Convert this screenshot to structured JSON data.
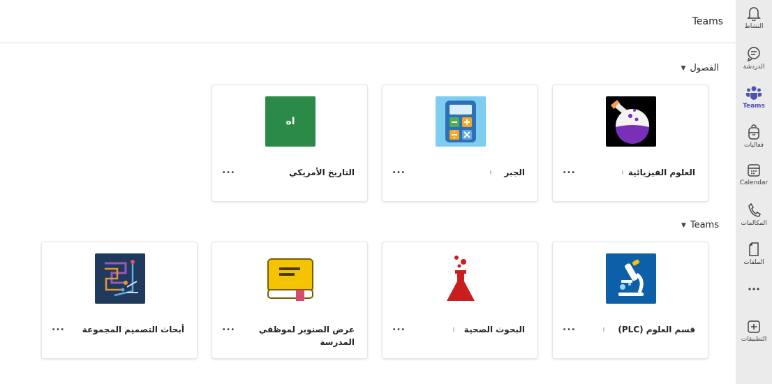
{
  "header": {
    "title": "Teams"
  },
  "rail": {
    "items": [
      {
        "label": "النشاط",
        "icon": "bell-icon"
      },
      {
        "label": "الدردشة",
        "icon": "chat-icon"
      },
      {
        "label": "Teams",
        "icon": "teams-icon",
        "active": true
      },
      {
        "label": "فعاليات",
        "icon": "backpack-icon"
      },
      {
        "label": "Calendar",
        "icon": "calendar-icon"
      },
      {
        "label": "المكالمات",
        "icon": "phone-icon"
      },
      {
        "label": "الملفات",
        "icon": "file-icon"
      },
      {
        "label": "",
        "icon": "more-icon"
      },
      {
        "label": "التطبيقات",
        "icon": "add-apps-icon"
      }
    ]
  },
  "sections": {
    "classes": {
      "heading": "الفصول",
      "cards": [
        {
          "name": "العلوم الفيزيائية",
          "icon": "flask-icon"
        },
        {
          "name": "الجبر",
          "icon": "calculator-icon"
        },
        {
          "name": "التاريخ الأمريكي",
          "icon": "initials-icon",
          "initials": "اه"
        }
      ]
    },
    "teams": {
      "heading": "Teams",
      "cards": [
        {
          "name": "قسم العلوم (PLC)",
          "icon": "microscope-icon"
        },
        {
          "name": "البحوث الصحية",
          "icon": "beaker-icon"
        },
        {
          "name": "عرض الصنوبر لموظفي المدرسة",
          "icon": "book-icon"
        },
        {
          "name": "أبحاث التصميم المجموعة",
          "icon": "circuit-icon"
        }
      ]
    }
  },
  "more_label": "...",
  "colors": {
    "accent": "#4f52b2",
    "initials_tile": "#2b8a47",
    "calculator_bg": "#7ecdf0",
    "flask_purple": "#7a2fb8",
    "microscope_bg": "#0d5fa8",
    "beaker_red": "#c81e1e",
    "book_yellow": "#f5c400",
    "circuit_bg": "#1f3a5c"
  }
}
